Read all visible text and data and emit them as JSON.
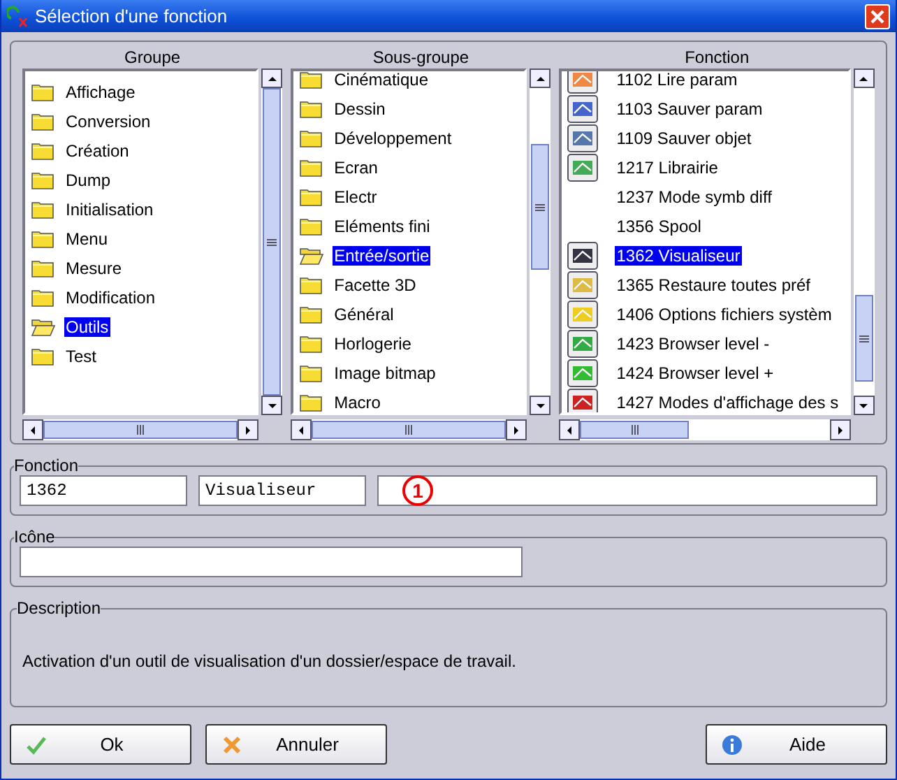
{
  "window": {
    "title": "Sélection d'une fonction"
  },
  "columns": [
    {
      "heading": "Groupe",
      "kind": "folders",
      "items": [
        {
          "label": "Affichage",
          "selected": false
        },
        {
          "label": "Conversion",
          "selected": false
        },
        {
          "label": "Création",
          "selected": false
        },
        {
          "label": "Dump",
          "selected": false
        },
        {
          "label": "Initialisation",
          "selected": false
        },
        {
          "label": "Menu",
          "selected": false
        },
        {
          "label": "Mesure",
          "selected": false
        },
        {
          "label": "Modification",
          "selected": false
        },
        {
          "label": "Outils",
          "selected": true
        },
        {
          "label": "Test",
          "selected": false
        }
      ]
    },
    {
      "heading": "Sous-groupe",
      "kind": "folders",
      "items": [
        {
          "label": "Cinématique",
          "selected": false
        },
        {
          "label": "Dessin",
          "selected": false
        },
        {
          "label": "Développement",
          "selected": false
        },
        {
          "label": "Ecran",
          "selected": false
        },
        {
          "label": "Electr",
          "selected": false
        },
        {
          "label": "Eléments fini",
          "selected": false
        },
        {
          "label": "Entrée/sortie",
          "selected": true
        },
        {
          "label": "Facette 3D",
          "selected": false
        },
        {
          "label": "Général",
          "selected": false
        },
        {
          "label": "Horlogerie",
          "selected": false
        },
        {
          "label": "Image bitmap",
          "selected": false
        },
        {
          "label": "Macro",
          "selected": false
        }
      ]
    },
    {
      "heading": "Fonction",
      "kind": "functions",
      "items": [
        {
          "label": "1102 Lire param",
          "selected": false,
          "kind": "icon"
        },
        {
          "label": "1103 Sauver param",
          "selected": false,
          "kind": "icon"
        },
        {
          "label": "1109 Sauver objet",
          "selected": false,
          "kind": "icon"
        },
        {
          "label": "1217 Librairie",
          "selected": false,
          "kind": "icon"
        },
        {
          "label": "1237 Mode symb diff",
          "selected": false,
          "kind": "plain"
        },
        {
          "label": "1356 Spool",
          "selected": false,
          "kind": "plain"
        },
        {
          "label": "1362 Visualiseur",
          "selected": true,
          "kind": "icon"
        },
        {
          "label": "1365 Restaure toutes préf",
          "selected": false,
          "kind": "icon"
        },
        {
          "label": "1406 Options fichiers systèm",
          "selected": false,
          "kind": "icon"
        },
        {
          "label": "1423 Browser level -",
          "selected": false,
          "kind": "icon"
        },
        {
          "label": "1424 Browser level +",
          "selected": false,
          "kind": "icon"
        },
        {
          "label": "1427 Modes d'affichage des s",
          "selected": false,
          "kind": "icon"
        }
      ]
    }
  ],
  "fonction": {
    "legend": "Fonction",
    "number": "1362",
    "name": "Visualiseur",
    "callout": "1"
  },
  "icone": {
    "legend": "Icône"
  },
  "description": {
    "legend": "Description",
    "text": "Activation d'un outil de visualisation d'un dossier/espace de travail."
  },
  "buttons": [
    {
      "label": "Ok",
      "kind": "ok"
    },
    {
      "label": "Annuler",
      "kind": "cancel"
    },
    {
      "label": "Aide",
      "kind": "help"
    }
  ]
}
